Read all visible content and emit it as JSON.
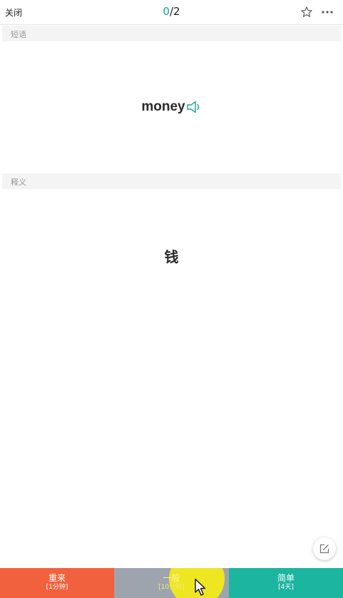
{
  "header": {
    "close_label": "关闭",
    "progress_current": "0",
    "progress_total": "/2",
    "star_icon": "star-outline-icon",
    "more_icon": "more-horizontal-icon"
  },
  "sections": {
    "phrase_label": "短语",
    "definition_label": "释义"
  },
  "card": {
    "word": "money",
    "speaker_icon": "speaker-icon",
    "definition": "钱"
  },
  "edit_icon": "edit-icon",
  "buttons": [
    {
      "label": "重来",
      "interval": "[1分钟]",
      "color": "#f2613d"
    },
    {
      "label": "一般",
      "interval": "[10分钟]",
      "color": "#9da4ae"
    },
    {
      "label": "简单",
      "interval": "[4天]",
      "color": "#1cb5a0"
    }
  ],
  "colors": {
    "accent": "#1a9e8f",
    "highlight": "#f5ec14"
  }
}
